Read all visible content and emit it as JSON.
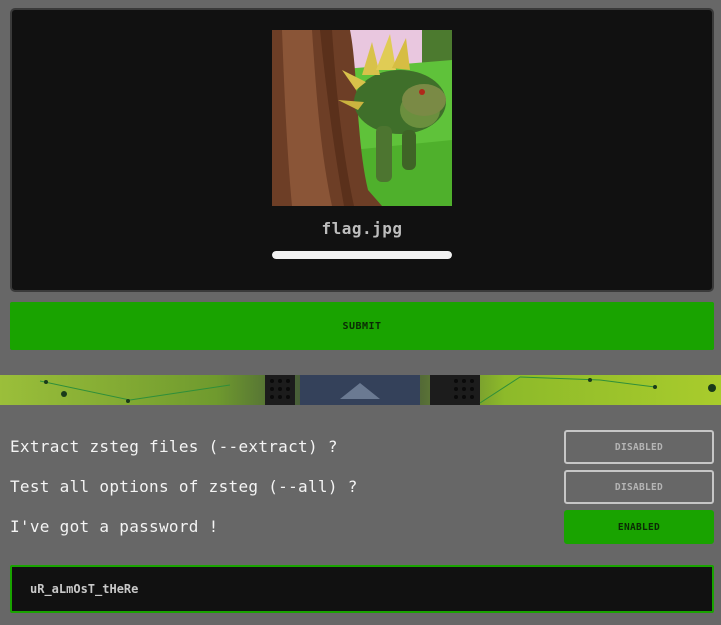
{
  "upload": {
    "filename": "flag.jpg",
    "progress_percent": 100
  },
  "submit_label": "SUBMIT",
  "options": [
    {
      "label": "Extract zsteg files (--extract) ?",
      "state": "DISABLED"
    },
    {
      "label": "Test all options of zsteg (--all) ?",
      "state": "DISABLED"
    },
    {
      "label": "I've got a password !",
      "state": "ENABLED"
    }
  ],
  "password": {
    "value": "uR_aLmOsT_tHeRe"
  },
  "colors": {
    "background": "#676767",
    "panel": "#111111",
    "accent_green": "#19a300"
  }
}
